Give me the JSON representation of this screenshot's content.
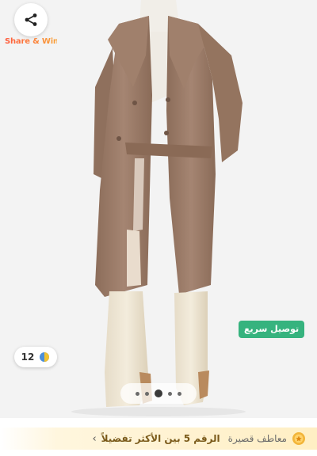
{
  "product": {
    "image_alt": "Women's brown long coat with white turtleneck and cream boots",
    "photo_count": "12"
  },
  "share": {
    "label": "Share & Win",
    "icon": "share-icon"
  },
  "badges": {
    "express_delivery": "توصيل سريع"
  },
  "carousel": {
    "dots": 5,
    "active_index": 2
  },
  "ranking": {
    "category": "معاطف قصيرة",
    "rank_text": "الرقم 5 بين الأكثر تفضيلاً",
    "chevron": "‹"
  },
  "colors": {
    "express_green": "#36b37e",
    "share_gradient_start": "#ff5a3c",
    "share_gradient_end": "#f9a23a",
    "rank_text": "#7a5a1a",
    "coat": "#9a7a66"
  }
}
